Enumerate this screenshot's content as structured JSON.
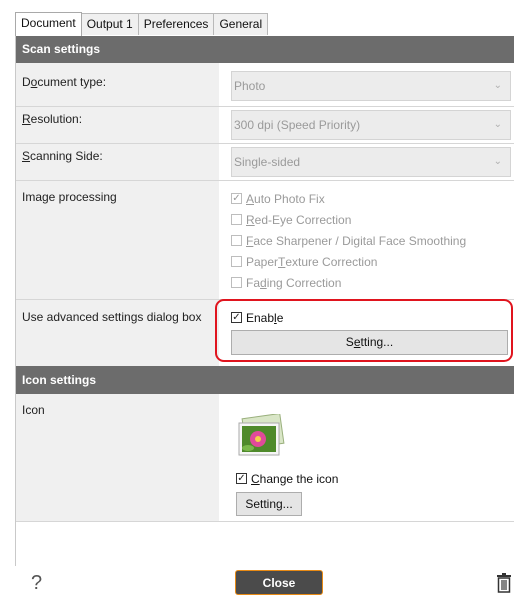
{
  "tabs": [
    "Document",
    "Output 1",
    "Preferences",
    "General"
  ],
  "scan_settings": {
    "header": "Scan settings",
    "document_type": {
      "label_pre": "D",
      "label_u": "o",
      "label_post": "cument type:",
      "value": "Photo"
    },
    "resolution": {
      "label_u": "R",
      "label_post": "esolution:",
      "value": "300 dpi (Speed Priority)"
    },
    "scanning_side": {
      "label_u": "S",
      "label_post": "canning Side:",
      "value": "Single-sided"
    },
    "image_processing": {
      "label": "Image processing",
      "options": [
        {
          "u": "A",
          "rest": "uto Photo Fix",
          "checked": true
        },
        {
          "u": "R",
          "rest": "ed-Eye Correction",
          "checked": false
        },
        {
          "u": "F",
          "rest": "ace Sharpener / Digital Face Smoothing",
          "checked": false
        },
        {
          "pre": "Paper ",
          "u": "T",
          "rest": "exture Correction",
          "checked": false
        },
        {
          "pre": "Fa",
          "u": "d",
          "rest": "ing Correction",
          "checked": false
        }
      ]
    },
    "advanced": {
      "label": "Use advanced settings dialog box",
      "enable_pre": "Enab",
      "enable_u": "l",
      "enable_post": "e",
      "enable_checked": true,
      "setting_pre": "S",
      "setting_u": "e",
      "setting_post": "tting..."
    }
  },
  "icon_settings": {
    "header": "Icon settings",
    "icon_label": "Icon",
    "change_u": "C",
    "change_post": "hange the icon",
    "change_checked": true,
    "setting_label": "Setting..."
  },
  "footer": {
    "help": "?",
    "close": "Close"
  }
}
